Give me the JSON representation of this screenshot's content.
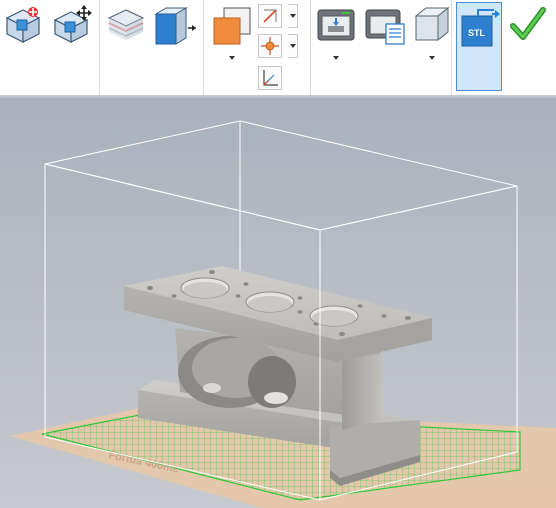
{
  "toolbar": {
    "groups": [
      {
        "name": "positioning",
        "tools": [
          "move-to-plate",
          "move"
        ]
      },
      {
        "name": "slicing",
        "tools": [
          "slice-layers",
          "extrude-view"
        ]
      },
      {
        "name": "support",
        "tools": [
          "support-structure",
          "support-line",
          "support-point",
          "support-axis"
        ]
      },
      {
        "name": "build",
        "tools": [
          "build-setup",
          "build-job",
          "build-box"
        ]
      },
      {
        "name": "export",
        "tools": [
          "export-stl",
          "accept"
        ]
      }
    ],
    "stl_label": "STL",
    "accent": "#2f7fd1",
    "accept_color": "#3aa33a"
  },
  "viewport": {
    "plate_label": "Fortus 400mc",
    "plate_color": "#e8c8a8",
    "grid_color": "#2ec83a",
    "bbox_color": "#ffffff",
    "part_color": "#b8b6b2"
  }
}
